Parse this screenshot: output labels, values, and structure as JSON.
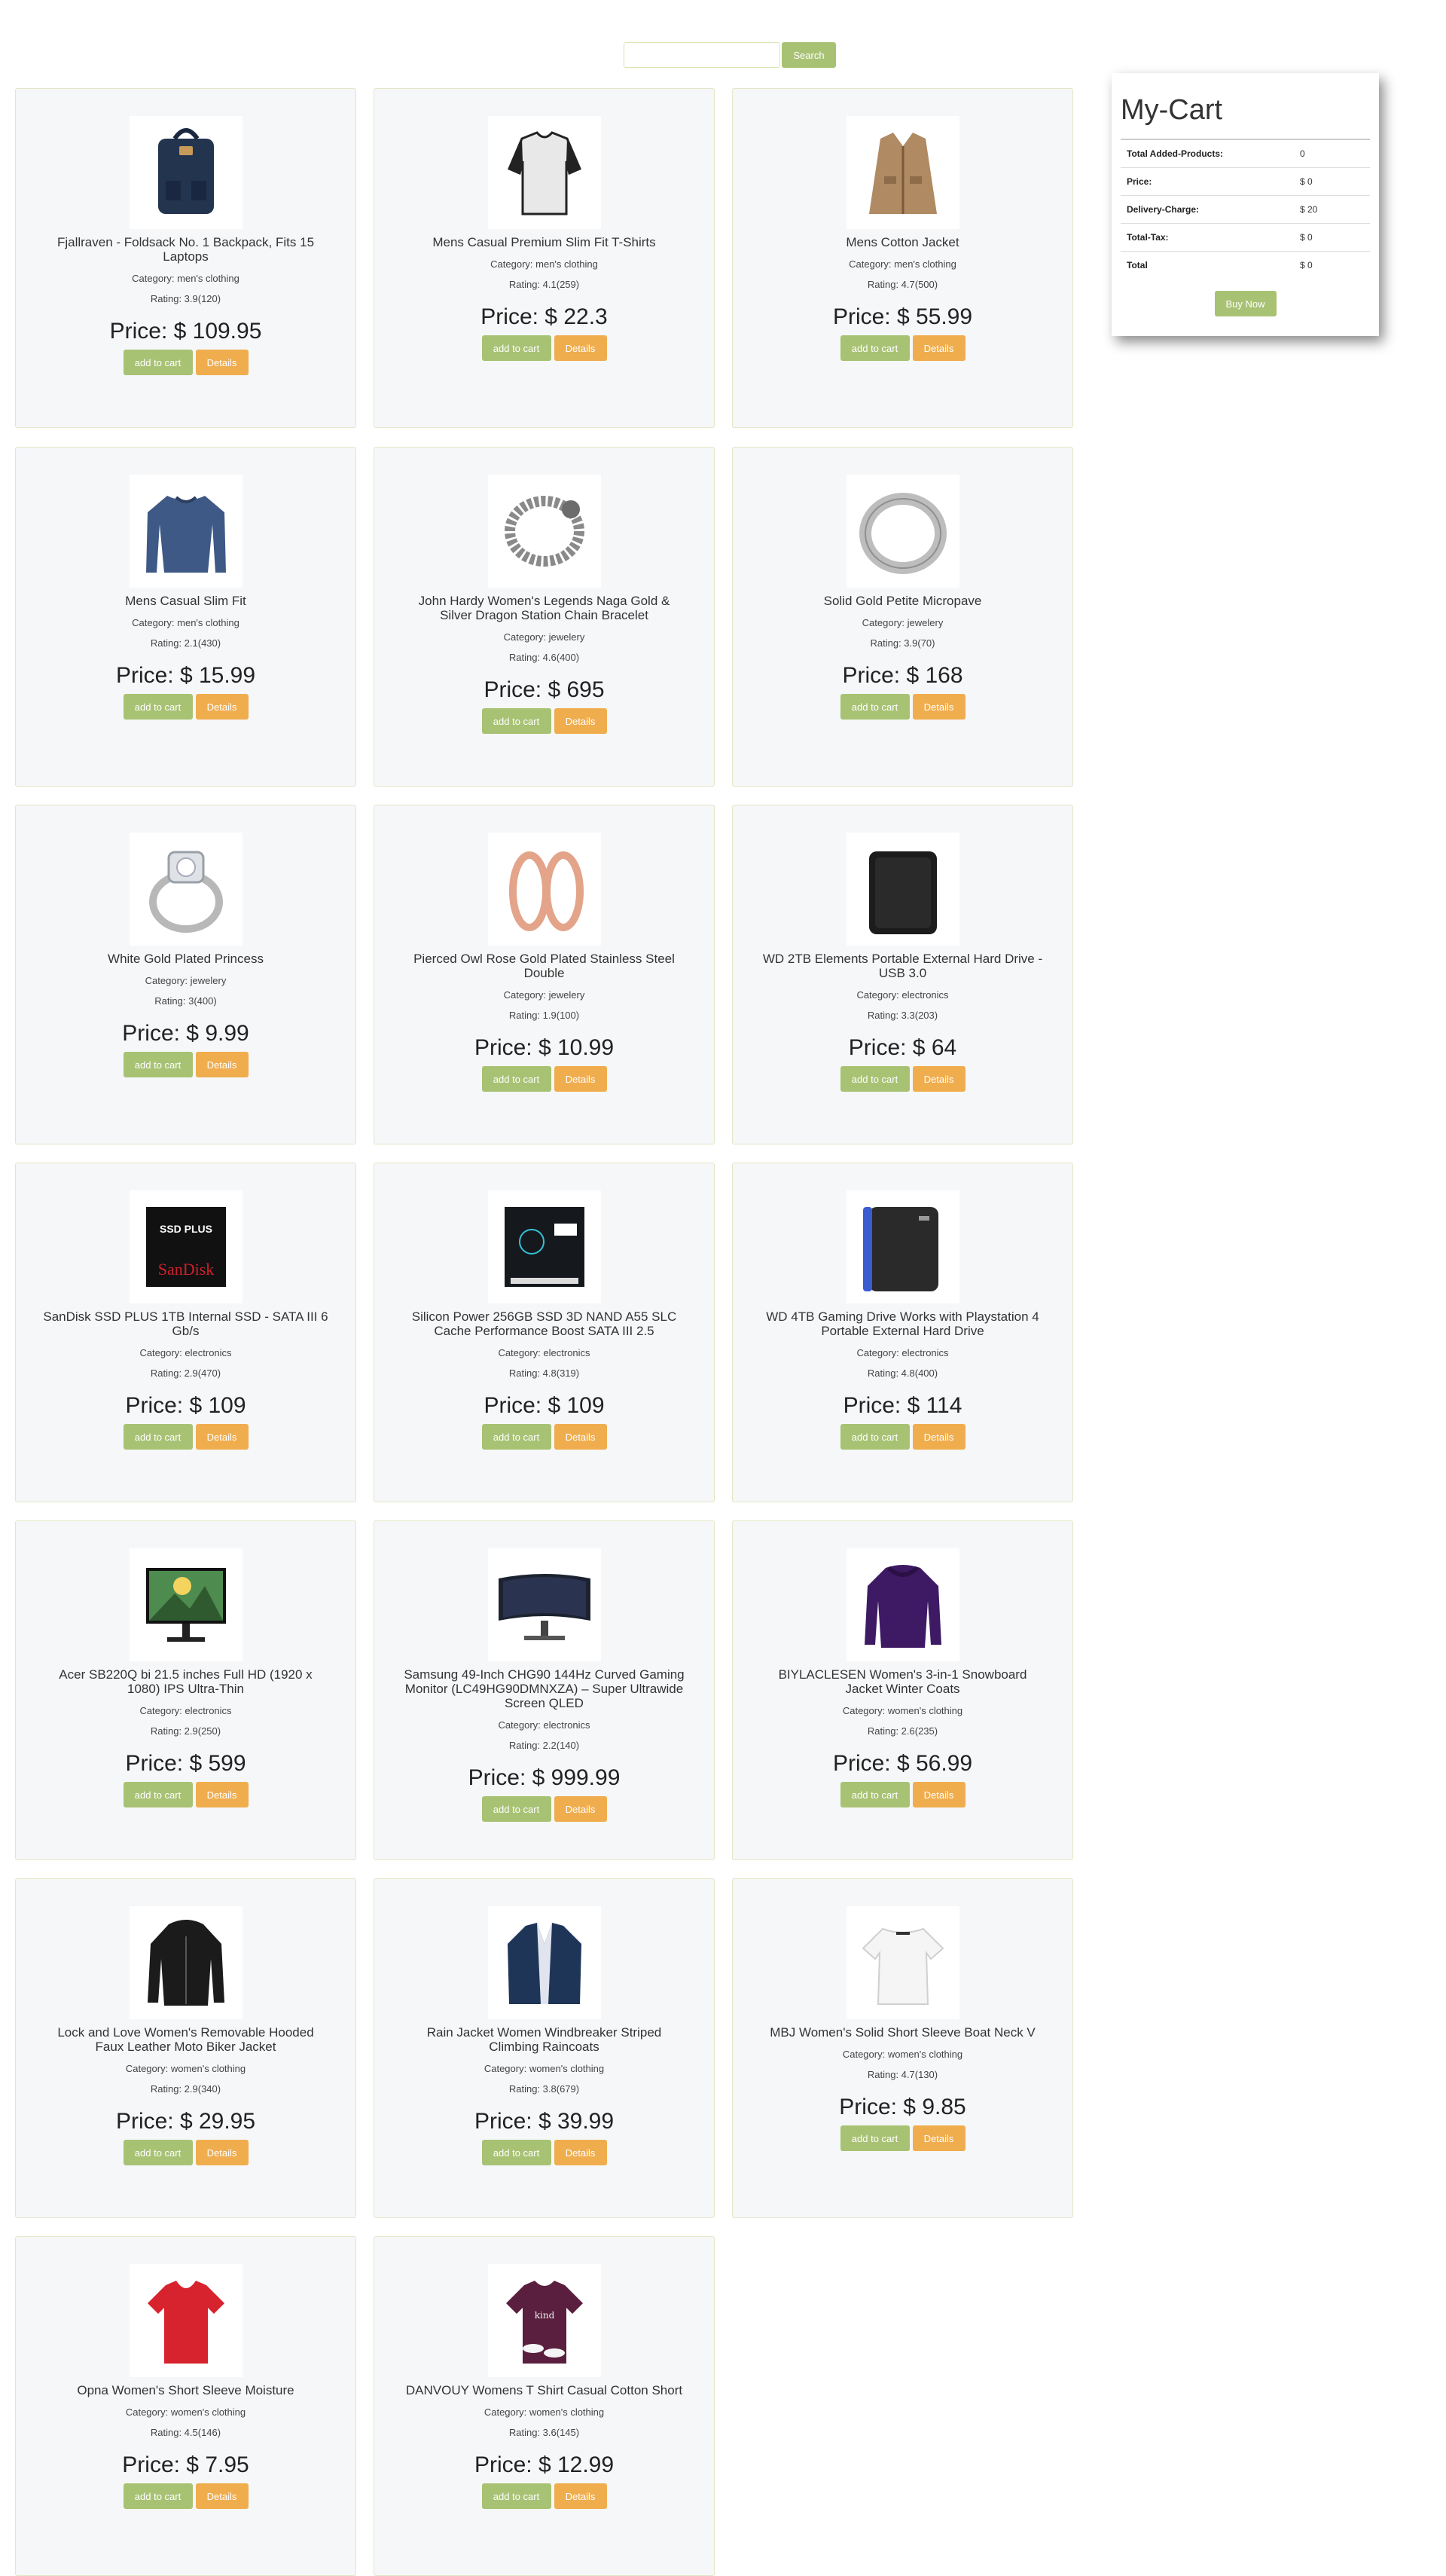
{
  "search": {
    "placeholder": "",
    "value": "",
    "button_label": "Search"
  },
  "colors": {
    "accent_green": "#a8c274",
    "accent_orange": "#f0ad4e",
    "card_bg": "#f6f7f9"
  },
  "buttons": {
    "add_to_cart": "add to cart",
    "details": "Details"
  },
  "products": [
    {
      "title": "Fjallraven - Foldsack No. 1 Backpack, Fits 15 Laptops",
      "category": "Category: men's clothing",
      "rating": "Rating: 3.9(120)",
      "price": "Price: $ 109.95",
      "image_icon": "backpack-icon"
    },
    {
      "title": "Mens Casual Premium Slim Fit T-Shirts",
      "category": "Category: men's clothing",
      "rating": "Rating: 4.1(259)",
      "price": "Price: $ 22.3",
      "image_icon": "tshirt-icon"
    },
    {
      "title": "Mens Cotton Jacket",
      "category": "Category: men's clothing",
      "rating": "Rating: 4.7(500)",
      "price": "Price: $ 55.99",
      "image_icon": "jacket-icon"
    },
    {
      "title": "Mens Casual Slim Fit",
      "category": "Category: men's clothing",
      "rating": "Rating: 2.1(430)",
      "price": "Price: $ 15.99",
      "image_icon": "longsleeve-icon"
    },
    {
      "title": "John Hardy Women's Legends Naga Gold & Silver Dragon Station Chain Bracelet",
      "category": "Category: jewelery",
      "rating": "Rating: 4.6(400)",
      "price": "Price: $ 695",
      "image_icon": "bracelet-icon"
    },
    {
      "title": "Solid Gold Petite Micropave",
      "category": "Category: jewelery",
      "rating": "Rating: 3.9(70)",
      "price": "Price: $ 168",
      "image_icon": "ring-icon"
    },
    {
      "title": "White Gold Plated Princess",
      "category": "Category: jewelery",
      "rating": "Rating: 3(400)",
      "price": "Price: $ 9.99",
      "image_icon": "diamond-ring-icon"
    },
    {
      "title": "Pierced Owl Rose Gold Plated Stainless Steel Double",
      "category": "Category: jewelery",
      "rating": "Rating: 1.9(100)",
      "price": "Price: $ 10.99",
      "image_icon": "ear-plug-icon"
    },
    {
      "title": "WD 2TB Elements Portable External Hard Drive - USB 3.0",
      "category": "Category: electronics",
      "rating": "Rating: 3.3(203)",
      "price": "Price: $ 64",
      "image_icon": "hard-drive-icon"
    },
    {
      "title": "SanDisk SSD PLUS 1TB Internal SSD - SATA III 6 Gb/s",
      "category": "Category: electronics",
      "rating": "Rating: 2.9(470)",
      "price": "Price: $ 109",
      "image_icon": "ssd-icon"
    },
    {
      "title": "Silicon Power 256GB SSD 3D NAND A55 SLC Cache Performance Boost SATA III 2.5",
      "category": "Category: electronics",
      "rating": "Rating: 4.8(319)",
      "price": "Price: $ 109",
      "image_icon": "ssd-silicon-icon"
    },
    {
      "title": "WD 4TB Gaming Drive Works with Playstation 4 Portable External Hard Drive",
      "category": "Category: electronics",
      "rating": "Rating: 4.8(400)",
      "price": "Price: $ 114",
      "image_icon": "gaming-drive-icon"
    },
    {
      "title": "Acer SB220Q bi 21.5 inches Full HD (1920 x 1080) IPS Ultra-Thin",
      "category": "Category: electronics",
      "rating": "Rating: 2.9(250)",
      "price": "Price: $ 599",
      "image_icon": "monitor-icon"
    },
    {
      "title": "Samsung 49-Inch CHG90 144Hz Curved Gaming Monitor (LC49HG90DMNXZA) – Super Ultrawide Screen QLED",
      "category": "Category: electronics",
      "rating": "Rating: 2.2(140)",
      "price": "Price: $ 999.99",
      "image_icon": "curved-monitor-icon"
    },
    {
      "title": "BIYLACLESEN Women's 3-in-1 Snowboard Jacket Winter Coats",
      "category": "Category: women's clothing",
      "rating": "Rating: 2.6(235)",
      "price": "Price: $ 56.99",
      "image_icon": "winter-coat-icon"
    },
    {
      "title": "Lock and Love Women's Removable Hooded Faux Leather Moto Biker Jacket",
      "category": "Category: women's clothing",
      "rating": "Rating: 2.9(340)",
      "price": "Price: $ 29.95",
      "image_icon": "leather-jacket-icon"
    },
    {
      "title": "Rain Jacket Women Windbreaker Striped Climbing Raincoats",
      "category": "Category: women's clothing",
      "rating": "Rating: 3.8(679)",
      "price": "Price: $ 39.99",
      "image_icon": "rain-jacket-icon"
    },
    {
      "title": "MBJ Women's Solid Short Sleeve Boat Neck V",
      "category": "Category: women's clothing",
      "rating": "Rating: 4.7(130)",
      "price": "Price: $ 9.85",
      "image_icon": "white-top-icon"
    },
    {
      "title": "Opna Women's Short Sleeve Moisture",
      "category": "Category: women's clothing",
      "rating": "Rating: 4.5(146)",
      "price": "Price: $ 7.95",
      "image_icon": "red-tshirt-icon"
    },
    {
      "title": "DANVOUY Womens T Shirt Casual Cotton Short",
      "category": "Category: women's clothing",
      "rating": "Rating: 3.6(145)",
      "price": "Price: $ 12.99",
      "image_icon": "purple-tshirt-icon"
    }
  ],
  "cart": {
    "title": "My-Cart",
    "rows": [
      {
        "label": "Total Added-Products:",
        "value": "0"
      },
      {
        "label": "Price:",
        "value": "$ 0"
      },
      {
        "label": "Delivery-Charge:",
        "value": "$ 20"
      },
      {
        "label": "Total-Tax:",
        "value": "$ 0"
      },
      {
        "label": "Total",
        "value": "$ 0"
      }
    ],
    "buy_label": "Buy Now"
  }
}
